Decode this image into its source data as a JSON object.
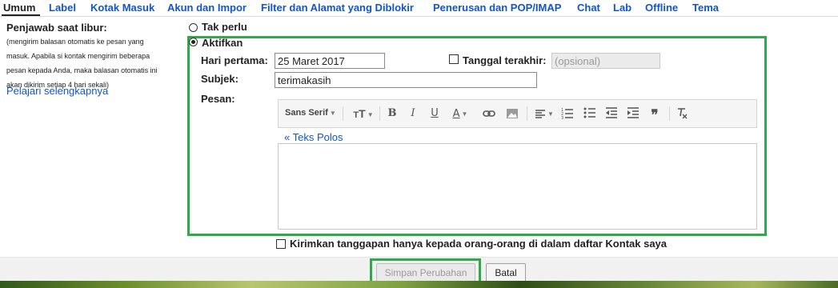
{
  "tabs": [
    {
      "label": "Umum",
      "active": true
    },
    {
      "label": "Label"
    },
    {
      "label": "Kotak Masuk"
    },
    {
      "label": "Akun dan Impor"
    },
    {
      "label": "Filter dan Alamat yang Diblokir"
    },
    {
      "label": "Penerusan dan POP/IMAP"
    },
    {
      "label": "Chat"
    },
    {
      "label": "Lab"
    },
    {
      "label": "Offline"
    },
    {
      "label": "Tema"
    }
  ],
  "section": {
    "title": "Penjawab saat libur:",
    "desc_lines": [
      "(mengirim balasan otomatis ke pesan yang",
      "masuk. Apabila si kontak mengirim beberapa",
      "pesan kepada Anda, maka balasan otomatis ini",
      "akan dikirim setiap 4 hari sekali)"
    ],
    "learn_more": "Pelajari selengkapnya"
  },
  "options": {
    "off_label": "Tak perlu",
    "on_label": "Aktifkan",
    "selected": "on"
  },
  "form": {
    "first_day_label": "Hari pertama:",
    "first_day_value": "25 Maret 2017",
    "last_day_label": "Tanggal terakhir:",
    "last_day_placeholder": "(opsional)",
    "subject_label": "Subjek:",
    "subject_value": "terimakasih",
    "message_label": "Pesan:",
    "plain_text_link": "« Teks Polos"
  },
  "toolbar": {
    "font_label": "Sans Serif",
    "icons": [
      "font-size-icon",
      "bold-icon",
      "italic-icon",
      "underline-icon",
      "text-color-icon",
      "link-icon",
      "image-icon",
      "align-icon",
      "numbered-list-icon",
      "bulleted-list-icon",
      "indent-less-icon",
      "indent-more-icon",
      "quote-icon",
      "remove-formatting-icon"
    ]
  },
  "contacts_only_label": "Kirimkan tanggapan hanya kepada orang-orang di dalam daftar Kontak saya",
  "buttons": {
    "save": "Simpan Perubahan",
    "cancel": "Batal"
  },
  "colors": {
    "link": "#1155cc",
    "highlight": "#2eaa4b"
  }
}
